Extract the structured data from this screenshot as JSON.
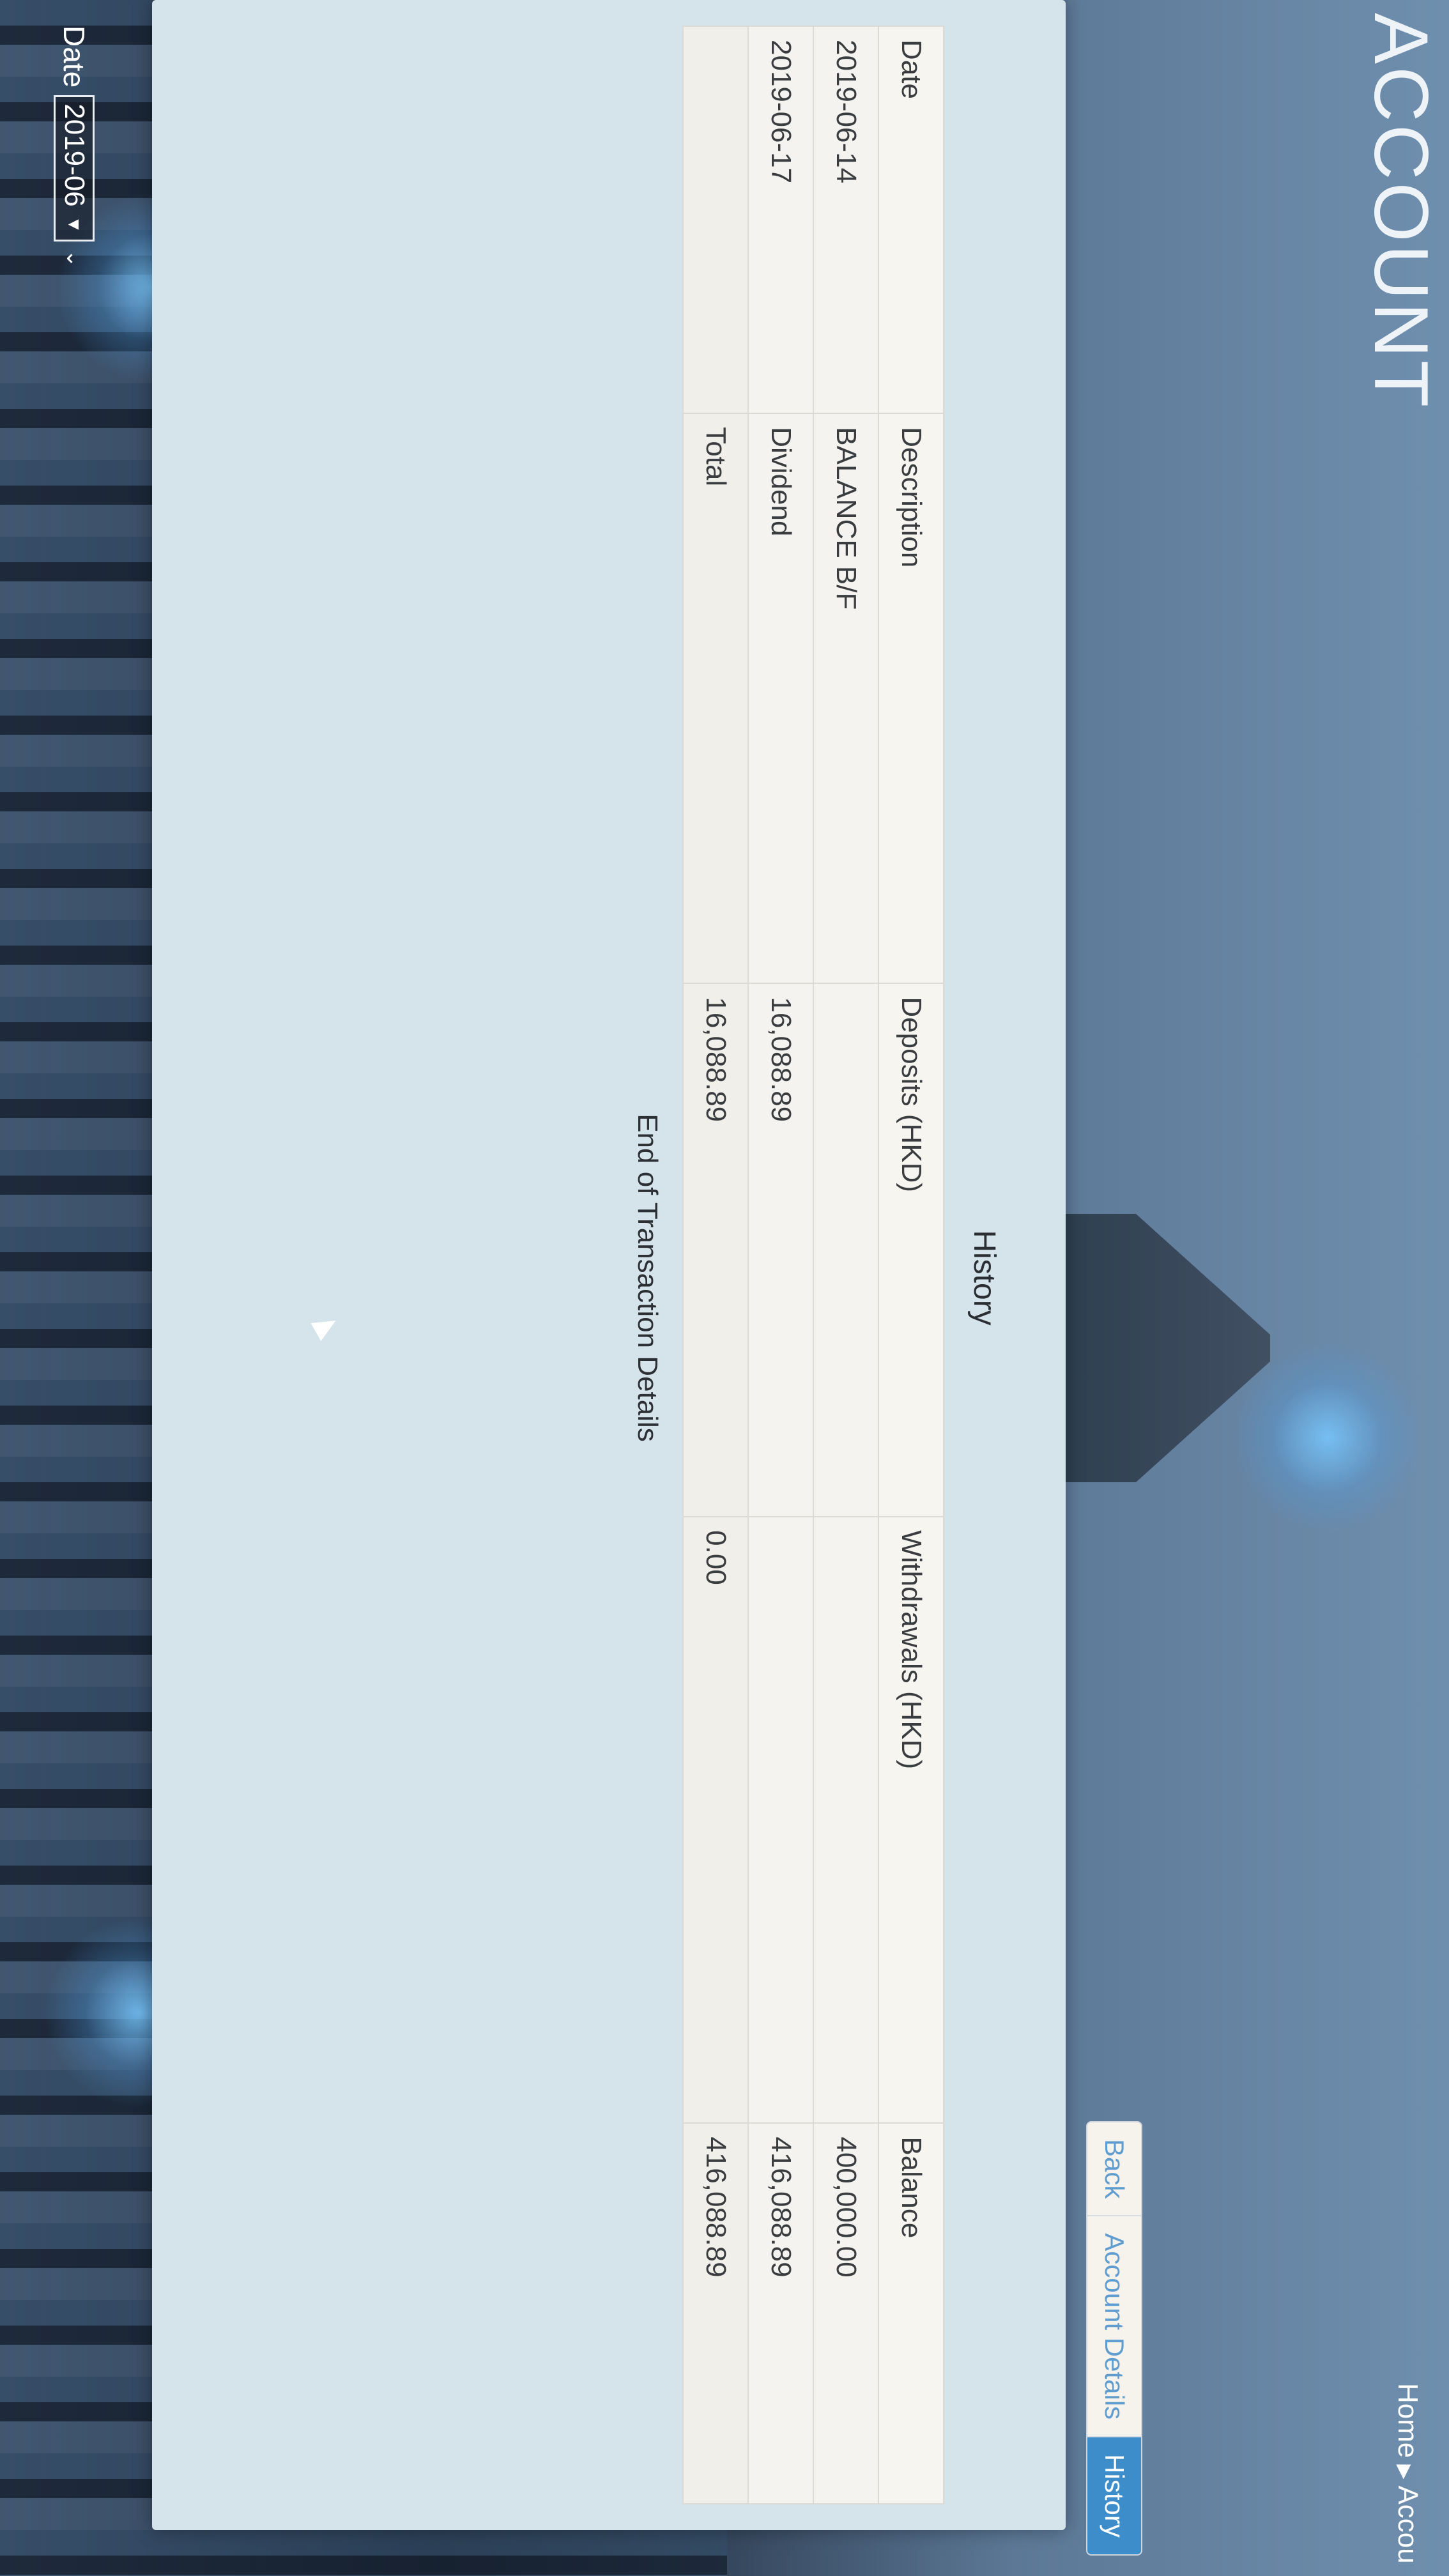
{
  "header": {
    "title": "ACCOUNT",
    "breadcrumb": {
      "home": "Home",
      "current": "Accou"
    }
  },
  "filter": {
    "label": "Date",
    "selected": "2019-06"
  },
  "tabs": [
    {
      "label": "Back",
      "active": false
    },
    {
      "label": "Account Details",
      "active": false
    },
    {
      "label": "History",
      "active": true
    }
  ],
  "table": {
    "title": "History",
    "columns": [
      "Date",
      "Description",
      "Deposits (HKD)",
      "Withdrawals (HKD)",
      "Balance"
    ],
    "rows": [
      [
        "2019-06-14",
        "BALANCE B/F",
        "",
        "",
        "400,000.00"
      ],
      [
        "2019-06-17",
        "Dividend",
        "16,088.89",
        "",
        "416,088.89"
      ]
    ],
    "total": [
      "",
      "Total",
      "16,088.89",
      "0.00",
      "416,088.89"
    ],
    "footer": "End of Transaction Details"
  },
  "colors": {
    "accent": "#3d8dcb",
    "card": "#d5e3eb",
    "table_bg": "#f4f3ef"
  }
}
